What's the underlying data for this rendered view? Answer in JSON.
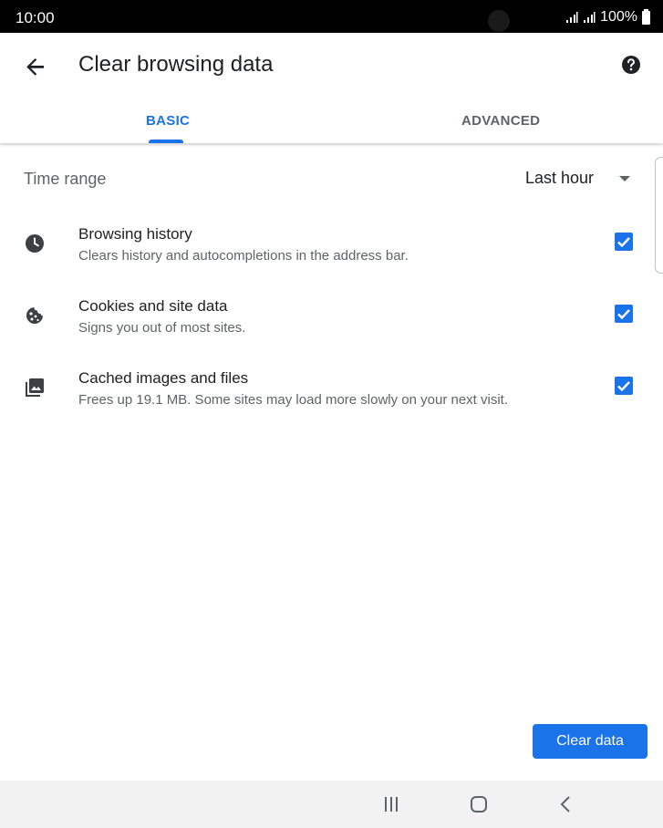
{
  "status_bar": {
    "time": "10:00",
    "battery": "100%"
  },
  "header": {
    "title": "Clear browsing data"
  },
  "tabs": [
    {
      "label": "BASIC",
      "selected": true
    },
    {
      "label": "ADVANCED",
      "selected": false
    }
  ],
  "time_range": {
    "label": "Time range",
    "value": "Last hour"
  },
  "options": [
    {
      "title": "Browsing history",
      "subtitle": "Clears history and autocompletions in the address bar.",
      "checked": true,
      "icon": "clock-icon"
    },
    {
      "title": "Cookies and site data",
      "subtitle": "Signs you out of most sites.",
      "checked": true,
      "icon": "cookie-icon"
    },
    {
      "title": "Cached images and files",
      "subtitle": "Frees up 19.1 MB. Some sites may load more slowly on your next visit.",
      "checked": true,
      "icon": "image-icon"
    }
  ],
  "clear_button": {
    "label": "Clear data"
  },
  "colors": {
    "accent": "#1a73e8",
    "secondary_text": "#5f6368"
  }
}
